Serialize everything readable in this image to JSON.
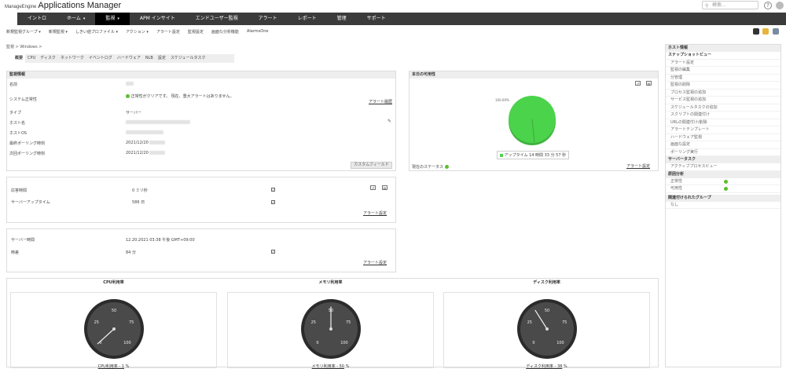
{
  "app": {
    "vendor": "ManageEngine",
    "name": "Applications Manager"
  },
  "search": {
    "placeholder": "検索..."
  },
  "help_label": "?",
  "nav": {
    "items": [
      "イントロ",
      "ホーム",
      "監視",
      "APM インサイト",
      "エンドユーザー監視",
      "アラート",
      "レポート",
      "管理",
      "サポート"
    ],
    "active": "監視"
  },
  "subnav": [
    "新規監視グループ ▾",
    "新規監視 ▾",
    "しきい値プロファイル ▾",
    "アクション ▾",
    "アラート設定",
    "監視設定",
    "画面な分析機能",
    "AlarmsOne"
  ],
  "breadcrumb": "監視 > Windows >",
  "tabs": [
    "概要",
    "CPU",
    "ディスク",
    "ネットワーク",
    "イベントログ",
    "ハードウェア",
    "NLB",
    "設定",
    "スケジュールタスク"
  ],
  "monitor_info": {
    "title": "監視情報",
    "labels": [
      "名前",
      "システム正常性",
      "タイプ",
      "ホスト名",
      "ホストOS",
      "最終ポーリング時刻",
      "次回ポーリング時刻"
    ],
    "health_text": "正常性がクリアです。 現在、重大アラートはありません。",
    "type_value": "サーバー",
    "last_poll": "2021/12/20",
    "next_poll": "2021/12/20",
    "alert_history": "アラート履歴",
    "custom_field": "カスタムフィールド"
  },
  "response": {
    "labels": [
      "応答時間",
      "サーバーアップタイム"
    ],
    "response_value": "0 ミリ秒",
    "uptime_value": "586 日",
    "alert_settings": "アラート設定"
  },
  "server_time": {
    "labels": [
      "サーバー時間",
      "時差"
    ],
    "time_value": "12.20.2021 03:38 午後 GMT+09:00",
    "diff_value": "84 分",
    "alert_settings": "アラート設定"
  },
  "availability": {
    "title": "本日の可用性",
    "pie_label": "100.00%",
    "legend": "アップタイム 14 時間 33 分 57 秒",
    "status_label": "現在のステータス",
    "alert_settings": "アラート設定",
    "uptime_percent": 100,
    "color": "#4bd34b"
  },
  "gauges": [
    {
      "title": "CPU利用率",
      "caption": "CPU利用率 - 1",
      "unit": "%",
      "value": 1
    },
    {
      "title": "メモリ利用率",
      "caption": "メモリ利用率 - 50",
      "unit": "%",
      "value": 50
    },
    {
      "title": "ディスク利用率",
      "caption": "ディスク利用率 - 38",
      "unit": "%",
      "value": 38
    }
  ],
  "gauge_ticks": [
    "0",
    "25",
    "50",
    "75",
    "100"
  ],
  "sidebar": {
    "host_info": "ホスト情報",
    "snapshot": "スナップショットビュー",
    "items": [
      "アラート設定",
      "監視の編集",
      "分管理",
      "監視の削除",
      "プロセス監視の追加",
      "サービス監視の追加",
      "スケジュールタスクの追加",
      "スクリプトの関連付け",
      "URLの関連付け/削除",
      "アラートテンプレート",
      "ハードウェア監視",
      "画面な設定",
      "ポーリング実行"
    ],
    "server_tasks": "サーバータスク",
    "server_task_items": [
      "アクティブプロセスビュー"
    ],
    "root_cause": "原因分析",
    "root_items": [
      "正常性",
      "可用性"
    ],
    "related_groups": "関連付けられたグループ",
    "related_value": "なし"
  }
}
